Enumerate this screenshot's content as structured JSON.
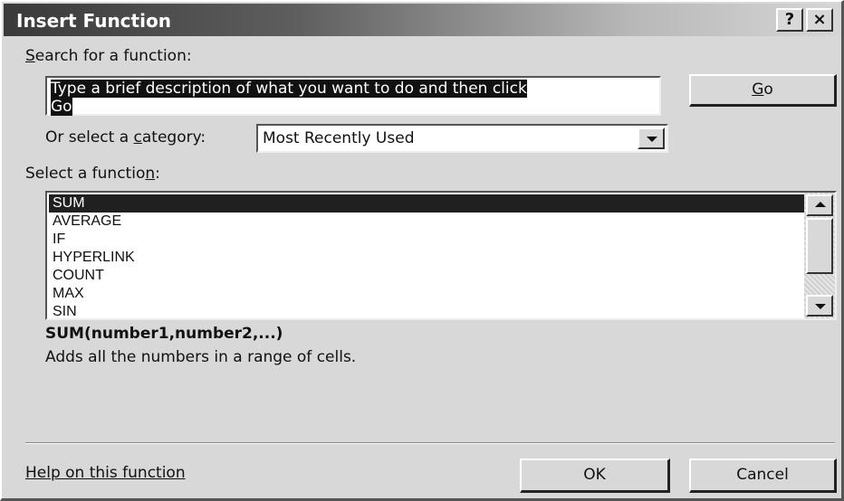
{
  "window": {
    "title": "Insert Function",
    "help_button": "?",
    "close_button": "×"
  },
  "search": {
    "label_underlined": "S",
    "label_rest": "earch for a function:",
    "value_line1": "Type a brief description of what you want to do and then click",
    "value_line2": "Go",
    "go_underlined": "G",
    "go_rest": "o"
  },
  "category": {
    "label_before": "Or select a ",
    "label_underlined": "c",
    "label_after": "ategory:",
    "selected": "Most Recently Used",
    "arrow_icon": "chevron-down-icon"
  },
  "function_list": {
    "label_before": "Select a functio",
    "label_underlined": "n",
    "label_after": ":",
    "items": [
      "SUM",
      "AVERAGE",
      "IF",
      "HYPERLINK",
      "COUNT",
      "MAX",
      "SIN"
    ],
    "selected_index": 0
  },
  "details": {
    "signature": "SUM(number1,number2,...)",
    "description": "Adds all the numbers in a range of cells."
  },
  "footer": {
    "help_link": "Help on this function",
    "ok_label": "OK",
    "cancel_label": "Cancel"
  },
  "colors": {
    "title_bar_dark": "#3a3a3a",
    "selection": "#202020",
    "face": "#d8d8d8"
  }
}
